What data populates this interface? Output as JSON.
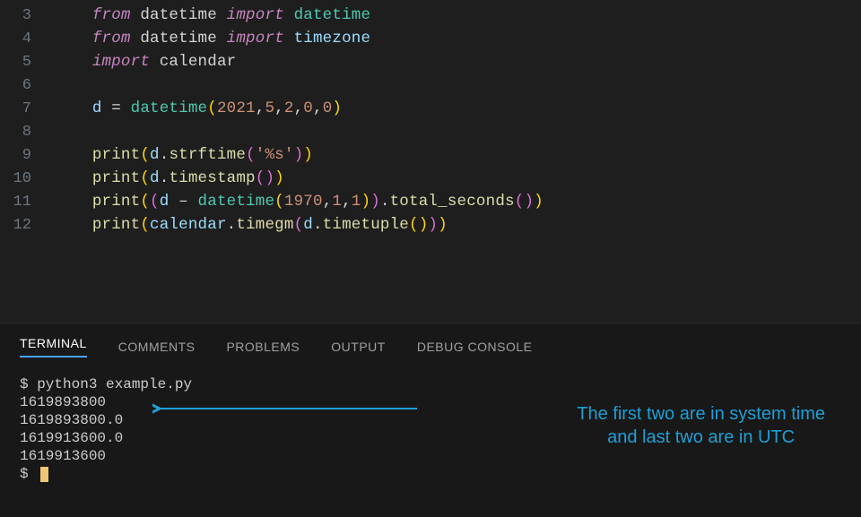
{
  "editor": {
    "lines": [
      {
        "num": 3,
        "html": "<span class='kw'>from</span> <span class='mod'>datetime</span> <span class='kw'>import</span> <span class='cls'>datetime</span>"
      },
      {
        "num": 4,
        "html": "<span class='kw'>from</span> <span class='mod'>datetime</span> <span class='kw'>import</span> <span class='cls2'>timezone</span>"
      },
      {
        "num": 5,
        "html": "<span class='kw'>import</span> <span class='mod'>calendar</span>"
      },
      {
        "num": 6,
        "html": ""
      },
      {
        "num": 7,
        "html": "<span class='var'>d</span> <span class='op'>=</span> <span class='cls'>datetime</span><span class='paren1'>(</span><span class='num'>2021</span><span class='p'>,</span><span class='num'>5</span><span class='p'>,</span><span class='num'>2</span><span class='p'>,</span><span class='num'>0</span><span class='p'>,</span><span class='num'>0</span><span class='paren1'>)</span>"
      },
      {
        "num": 8,
        "html": ""
      },
      {
        "num": 9,
        "html": "<span class='call'>print</span><span class='paren1'>(</span><span class='var'>d</span><span class='p'>.</span><span class='call'>strftime</span><span class='paren2'>(</span><span class='str'>'%s'</span><span class='paren2'>)</span><span class='paren1'>)</span>"
      },
      {
        "num": 10,
        "html": "<span class='call'>print</span><span class='paren1'>(</span><span class='var'>d</span><span class='p'>.</span><span class='call'>timestamp</span><span class='paren2'>(</span><span class='paren2'>)</span><span class='paren1'>)</span>"
      },
      {
        "num": 11,
        "html": "<span class='call'>print</span><span class='paren1'>(</span><span class='paren2'>(</span><span class='var'>d</span> <span class='op'>–</span> <span class='cls'>datetime</span><span class='paren1'>(</span><span class='num'>1970</span><span class='p'>,</span><span class='num'>1</span><span class='p'>,</span><span class='num'>1</span><span class='paren1'>)</span><span class='paren2'>)</span><span class='p'>.</span><span class='call'>total_seconds</span><span class='paren2'>(</span><span class='paren2'>)</span><span class='paren1'>)</span>"
      },
      {
        "num": 12,
        "html": "<span class='call'>print</span><span class='paren1'>(</span><span class='var'>calendar</span><span class='p'>.</span><span class='call'>timegm</span><span class='paren2'>(</span><span class='var'>d</span><span class='p'>.</span><span class='call'>timetuple</span><span class='paren1'>(</span><span class='paren1'>)</span><span class='paren2'>)</span><span class='paren1'>)</span>"
      }
    ]
  },
  "panel": {
    "tabs": {
      "terminal": "TERMINAL",
      "comments": "COMMENTS",
      "problems": "PROBLEMS",
      "output": "OUTPUT",
      "debug": "DEBUG CONSOLE"
    },
    "lines": [
      "$ python3 example.py",
      "1619893800",
      "1619893800.0",
      "1619913600.0",
      "1619913600",
      "$ "
    ]
  },
  "annotation": {
    "line1": "The first two are in system time",
    "line2": "and last two are in UTC"
  }
}
